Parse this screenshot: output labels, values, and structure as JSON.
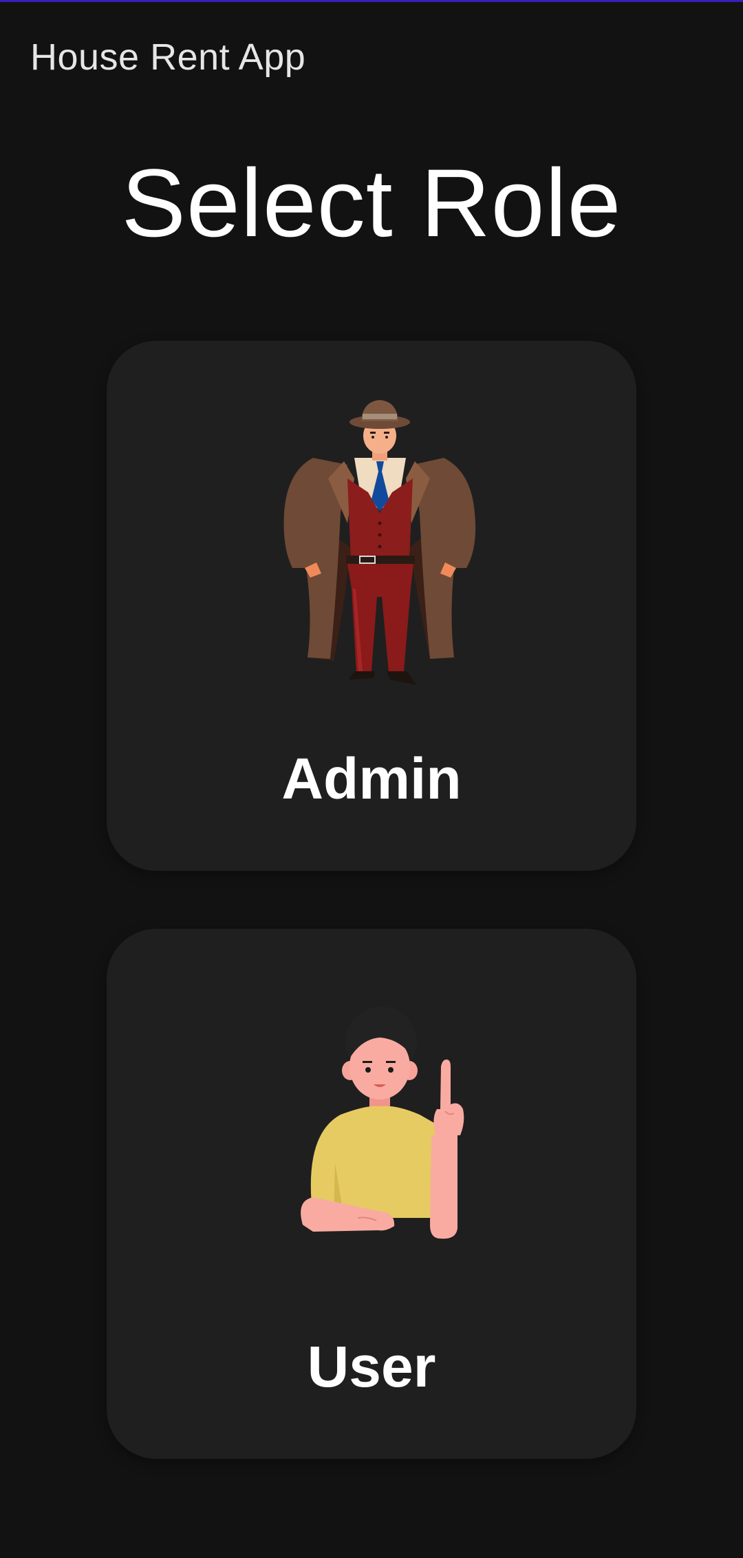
{
  "app_bar": {
    "title": "House Rent App"
  },
  "page": {
    "title": "Select Role"
  },
  "roles": [
    {
      "label": "Admin",
      "illustration": "detective-man-illustration"
    },
    {
      "label": "User",
      "illustration": "person-pointing-up-illustration"
    }
  ],
  "colors": {
    "background": "#121212",
    "card": "#1f1f1f",
    "text": "#ffffff",
    "accent_line": "#3a1fb8"
  }
}
